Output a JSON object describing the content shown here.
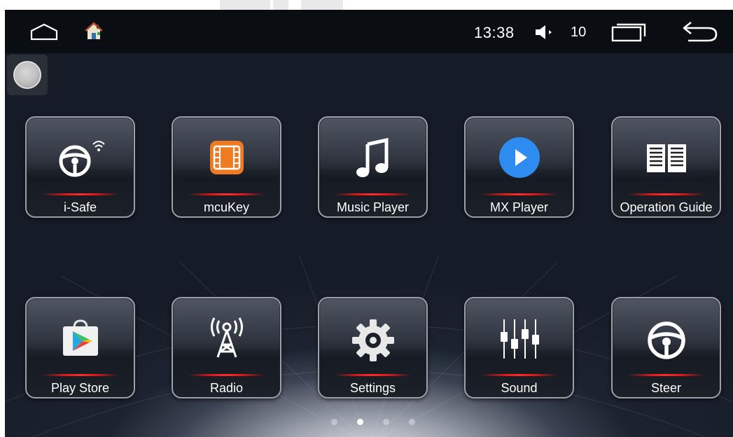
{
  "status_bar": {
    "clock": "13:38",
    "volume": "10",
    "icons": [
      "home-outline-icon",
      "launcher-house-icon",
      "speaker-icon",
      "recent-apps-icon",
      "back-arrow-icon"
    ]
  },
  "apps": [
    {
      "label": "i-Safe",
      "icon": "steering-wheel-wifi-icon"
    },
    {
      "label": "mcuKey",
      "icon": "film-strip-icon"
    },
    {
      "label": "Music Player",
      "icon": "music-note-icon"
    },
    {
      "label": "MX Player",
      "icon": "play-circle-icon"
    },
    {
      "label": "Operation Guide",
      "icon": "open-book-icon"
    },
    {
      "label": "Play Store",
      "icon": "play-store-bag-icon"
    },
    {
      "label": "Radio",
      "icon": "radio-tower-icon"
    },
    {
      "label": "Settings",
      "icon": "gear-icon"
    },
    {
      "label": "Sound",
      "icon": "equalizer-icon"
    },
    {
      "label": "Steer",
      "icon": "steering-wheel-icon"
    }
  ],
  "pager": {
    "pages": 4,
    "active_page": 2
  },
  "colors": {
    "accent_red": "#e01818",
    "status_bar_bg": "#0a0d12",
    "mx_blue": "#2e8cf0",
    "mcukey_orange": "#f07a22"
  }
}
